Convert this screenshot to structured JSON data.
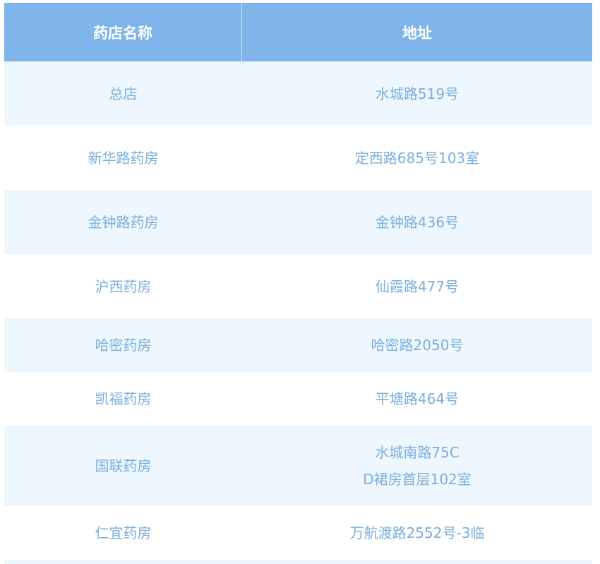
{
  "table": {
    "headers": {
      "name": "药店名称",
      "address": "地址"
    },
    "rows": [
      {
        "name": "总店",
        "address": [
          "水城路519号"
        ]
      },
      {
        "name": "新华路药房",
        "address": [
          "定西路685号103室"
        ]
      },
      {
        "name": "金钟路药房",
        "address": [
          "金钟路436号"
        ]
      },
      {
        "name": "沪西药房",
        "address": [
          "仙霞路477号"
        ]
      },
      {
        "name": "哈密药房",
        "address": [
          "哈密路2050号"
        ]
      },
      {
        "name": "凯福药房",
        "address": [
          "平塘路464号"
        ]
      },
      {
        "name": "国联药房",
        "address": [
          "水城南路75C",
          "D裙房首层102室"
        ]
      },
      {
        "name": "仁宜药房",
        "address": [
          "万航渡路2552号-3临"
        ]
      }
    ]
  },
  "colors": {
    "header_bg": "#7eb4ea",
    "row_alt_bg": "#eef7fe",
    "text": "#7aaedd"
  }
}
